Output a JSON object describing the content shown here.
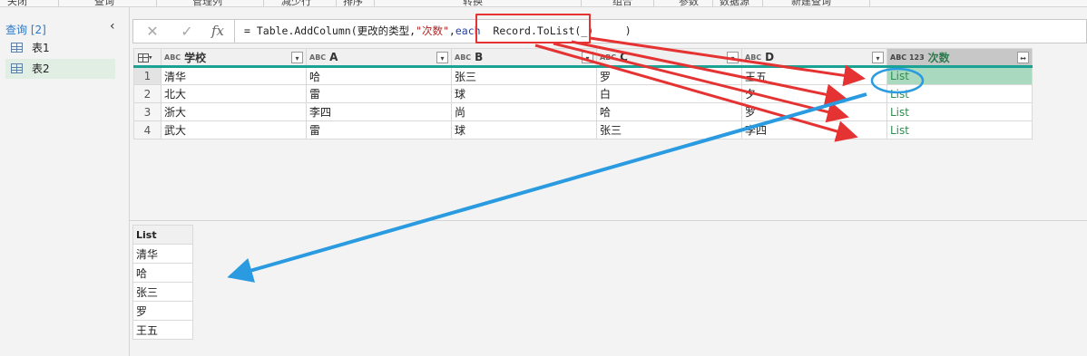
{
  "ribbon": {
    "tabs": [
      "关闭",
      "查询",
      "管理列",
      "减少行",
      "排序",
      "转换",
      "组合",
      "参数",
      "数据源",
      "新建查询"
    ]
  },
  "query_pane": {
    "title": "查询 [2]",
    "items": [
      {
        "label": "表1",
        "active": false
      },
      {
        "label": "表2",
        "active": true
      }
    ]
  },
  "formula_bar": {
    "cancel_icon": "close-icon",
    "confirm_icon": "check-icon",
    "fx_label": "fx",
    "formula_prefix": "= Table.AddColumn(更改的类型,",
    "formula_string": "\"次数\"",
    "formula_sep": ",",
    "formula_keyword": "each",
    "formula_highlight": "  Record.ToList(_)",
    "formula_suffix": "     )"
  },
  "table": {
    "columns": [
      {
        "type_icon": "ABC",
        "name": "学校"
      },
      {
        "type_icon": "ABC",
        "name": "A"
      },
      {
        "type_icon": "ABC",
        "name": "B"
      },
      {
        "type_icon": "ABC",
        "name": "C"
      },
      {
        "type_icon": "ABC",
        "name": "D"
      },
      {
        "type_icon": "ABC 123",
        "name": "次数"
      }
    ],
    "rows": [
      {
        "n": "1",
        "cells": [
          "清华",
          "哈",
          "张三",
          "罗",
          "王五",
          "List"
        ]
      },
      {
        "n": "2",
        "cells": [
          "北大",
          "雷",
          "球",
          "白",
          "夕",
          "List"
        ]
      },
      {
        "n": "3",
        "cells": [
          "浙大",
          "李四",
          "尚",
          "哈",
          "罗",
          "List"
        ]
      },
      {
        "n": "4",
        "cells": [
          "武大",
          "雷",
          "球",
          "张三",
          "李四",
          "List"
        ]
      }
    ]
  },
  "preview": {
    "header": "List",
    "values": [
      "清华",
      "哈",
      "张三",
      "罗",
      "王五"
    ]
  },
  "colors": {
    "accent_teal": "#1aa394",
    "annotation_red": "#e53333",
    "annotation_blue": "#2a9be0",
    "list_green": "#2f8f4f"
  }
}
